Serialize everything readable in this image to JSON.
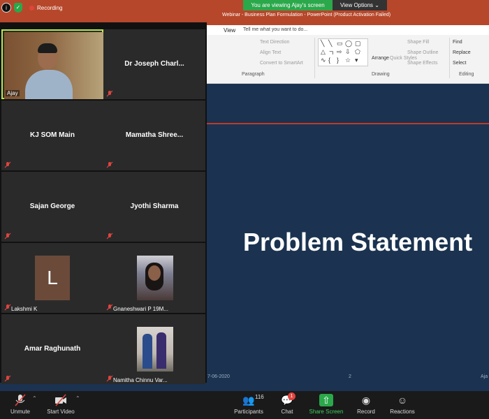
{
  "status": {
    "info_icon": "i",
    "recording_label": "Recording"
  },
  "banner": {
    "viewing_text": "You are viewing Ajay's screen",
    "view_options": "View Options ⌄"
  },
  "powerpoint": {
    "window_title": "Webinar - Business Plan Formulation - PowerPoint (Product Activation Failed)",
    "view_tab": "View",
    "tell_me": "Tell me what you want to do...",
    "ribbon": {
      "text_direction": "Text Direction",
      "align_text": "Align Text",
      "convert_smartart": "Convert to SmartArt",
      "paragraph_group": "Paragraph",
      "arrange": "Arrange",
      "quick_styles": "Quick Styles",
      "shape_fill": "Shape Fill",
      "shape_outline": "Shape Outline",
      "shape_effects": "Shape Effects",
      "drawing_group": "Drawing",
      "find": "Find",
      "replace": "Replace",
      "select": "Select",
      "editing_group": "Editing"
    },
    "slide": {
      "title": "Problem Statement",
      "date": "7-06-2020",
      "page_number": "2",
      "footer_right": "Aja"
    }
  },
  "gallery": {
    "tiles": [
      {
        "name": "Ajay",
        "active": true
      },
      {
        "name": "Dr Joseph Charl..."
      },
      {
        "name": "KJ SOM Main"
      },
      {
        "name": "Mamatha  Shree..."
      },
      {
        "name": "Sajan George"
      },
      {
        "name": "Jyothi Sharma"
      },
      {
        "name": "Lakshmi K",
        "avatar_letter": "L"
      },
      {
        "name": "Gnaneshwari P 19M..."
      },
      {
        "name": "Amar Raghunath"
      },
      {
        "name": "Namitha Chinnu Var..."
      }
    ]
  },
  "toolbar": {
    "unmute": "Unmute",
    "start_video": "Start Video",
    "participants": "Participants",
    "participants_count": "116",
    "chat": "Chat",
    "chat_badge": "1",
    "share_screen": "Share Screen",
    "record": "Record",
    "reactions": "Reactions"
  },
  "colors": {
    "slide_background": "#1b3350",
    "accent_green": "#2aa84a",
    "active_speaker_border": "#b9e84a",
    "powerpoint_red": "#b7472a"
  }
}
